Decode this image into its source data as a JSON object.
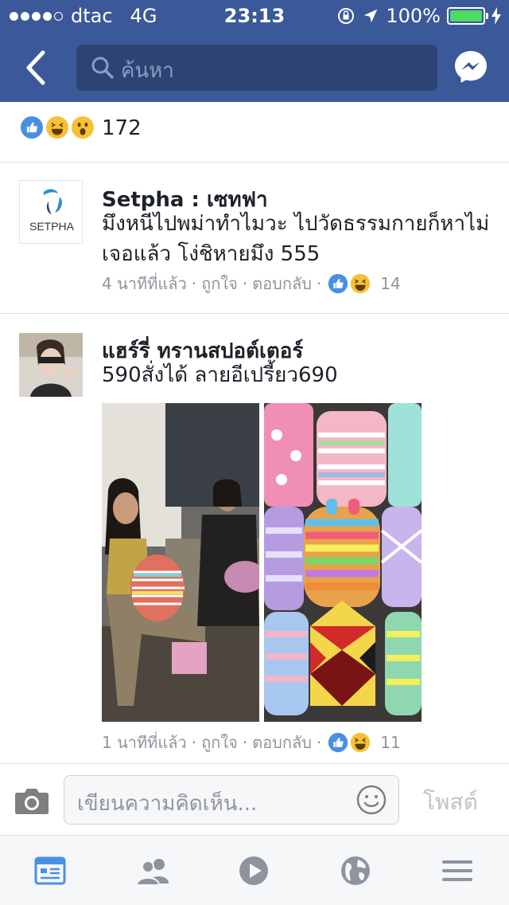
{
  "status_bar": {
    "carrier": "dtac",
    "network": "4G",
    "time": "23:13",
    "battery": "100%"
  },
  "nav": {
    "search_placeholder": "ค้นหา"
  },
  "reactions": {
    "count": "172",
    "types": [
      "like",
      "haha",
      "wow"
    ]
  },
  "comments": [
    {
      "author": "Setpha : เซทฟา",
      "avatar_label": "SETPHA",
      "text": "มึงหนีไปพม่าทำไมวะ ไปวัดธรรมกายก็หาไม่เจอแล้ว โง่ชิหายมึง 555",
      "time": "4 นาทีที่แล้ว",
      "like_label": "ถูกใจ",
      "reply_label": "ตอบกลับ",
      "reaction_count": "14"
    },
    {
      "author": "แฮร์รี่ ทรานสปอต์เตอร์",
      "text": "590สั่งได้ ลายอีเปรี้ยว690",
      "time": "1 นาทีที่แล้ว",
      "like_label": "ถูกใจ",
      "reply_label": "ตอบกลับ",
      "reaction_count": "11"
    }
  ],
  "composer": {
    "placeholder": "เขียนความคิดเห็น...",
    "post_label": "โพสต์"
  },
  "colors": {
    "brand": "#3b5998",
    "like": "#4a90e2",
    "emoji": "#f7c136",
    "meta": "#90949c"
  },
  "tabbar": {
    "icons": [
      "news-feed-icon",
      "friends-icon",
      "video-icon",
      "globe-icon",
      "menu-icon"
    ]
  }
}
